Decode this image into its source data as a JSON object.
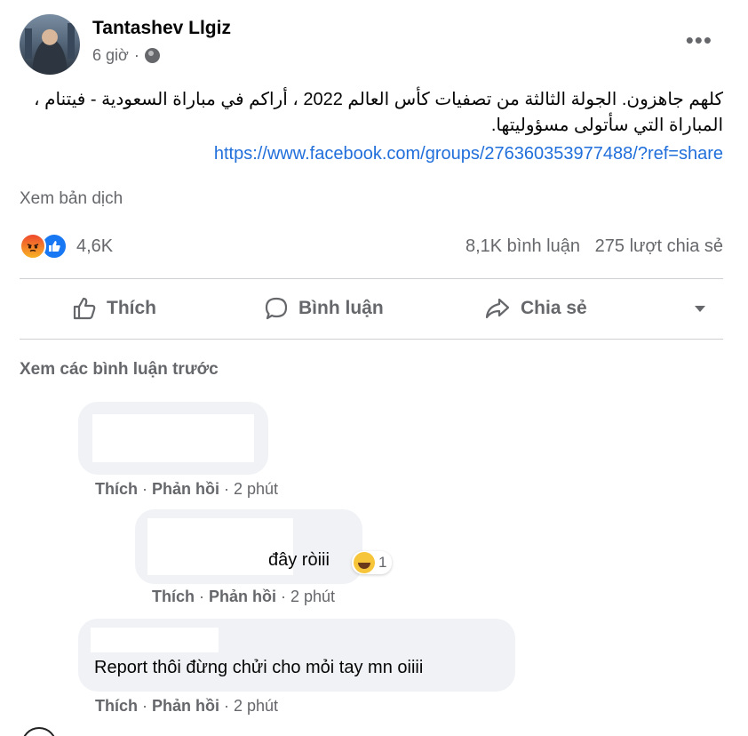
{
  "post": {
    "author": "Tantashev Llgiz",
    "time": "6 giờ",
    "text": "كلهم جاهزون. الجولة الثالثة من تصفيات كأس العالم 2022 ، أراكم في مباراة السعودية - فيتنام ، المباراة التي سأتولى مسؤوليتها.",
    "link": "https://www.facebook.com/groups/276360353977488/?ref=share",
    "see_translation": "Xem bản dịch",
    "reaction_count": "4,6K",
    "comment_count": "8,1K bình luận",
    "share_count": "275 lượt chia sẻ"
  },
  "actions": {
    "like": "Thích",
    "comment": "Bình luận",
    "share": "Chia sẻ"
  },
  "comments_section": {
    "view_previous": "Xem các bình luận trước",
    "comments": [
      {
        "text": "",
        "like": "Thích",
        "reply": "Phản hồi",
        "time": "2 phút"
      },
      {
        "text": "đây ròiii",
        "reaction_count": "1",
        "like": "Thích",
        "reply": "Phản hồi",
        "time": "2 phút"
      },
      {
        "text": "Report thôi đừng chửi cho mỏi tay mn oiiii",
        "like": "Thích",
        "reply": "Phản hồi",
        "time": "2 phút"
      }
    ]
  },
  "icons": {
    "reactions": [
      "angry-icon",
      "like-icon"
    ],
    "comment_reaction": "haha-icon"
  },
  "colors": {
    "link": "#216fdb",
    "secondary_text": "#65676b",
    "bubble": "#f0f2f5",
    "like_blue": "#1877f2"
  }
}
